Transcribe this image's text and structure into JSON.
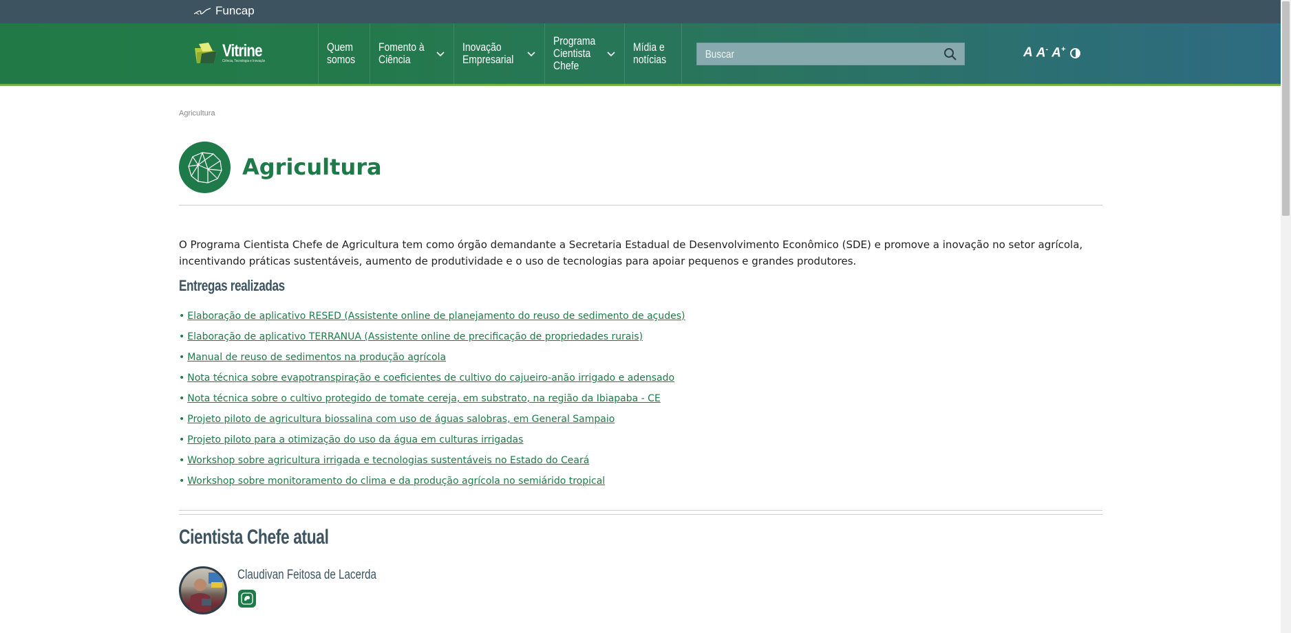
{
  "topbar": {
    "brand": "Funcap"
  },
  "header": {
    "logo_title": "Vitrine",
    "logo_tagline": "Ciência, Tecnologia e Inovação",
    "nav": [
      {
        "label": "Quem\nsomos",
        "has_dropdown": false
      },
      {
        "label": "Fomento à\nCiência",
        "has_dropdown": true
      },
      {
        "label": "Inovação\nEmpresarial",
        "has_dropdown": true
      },
      {
        "label": "Programa\nCientista\nChefe",
        "has_dropdown": true
      },
      {
        "label": "Mídia e\nnotícias",
        "has_dropdown": false
      }
    ],
    "search_placeholder": "Buscar",
    "a11y": {
      "font_normal": "A",
      "font_smaller": "A",
      "font_larger": "A"
    }
  },
  "breadcrumb": "Agricultura",
  "page_title": "Agricultura",
  "intro": "O Programa Cientista Chefe de Agricultura tem como órgão demandante a Secretaria Estadual de Desenvolvimento Econômico (SDE) e promove a inovação no setor agrícola, incentivando práticas sustentáveis, aumento de produtividade e o uso de tecnologias para apoiar pequenos e grandes produtores.",
  "deliveries_title": "Entregas realizadas",
  "deliveries": [
    "Elaboração de aplicativo RESED (Assistente online de planejamento do reuso de sedimento de açudes)",
    "Elaboração de aplicativo TERRANUA (Assistente online de precificação de propriedades rurais)",
    "Manual de reuso de sedimentos na produção agrícola",
    "Nota técnica sobre evapotranspiração e coeficientes de cultivo do cajueiro-anão irrigado e adensado",
    "Nota técnica sobre o cultivo protegido de tomate cereja, em substrato, na região da Ibiapaba - CE",
    "Projeto piloto de agricultura biossalina com uso de águas salobras, em General Sampaio",
    "Projeto piloto para a otimização do uso da água em culturas irrigadas",
    "Workshop sobre agricultura irrigada e tecnologias sustentáveis no Estado do Ceará",
    "Workshop sobre monitoramento do clima e da produção agrícola no semiárido tropical"
  ],
  "current_scientist_title": "Cientista Chefe atual",
  "scientist_name": "Claudivan Feitosa de Lacerda",
  "colors": {
    "primary_green": "#1e7a48",
    "top_strip": "#3d5360",
    "accent_line": "#6db33f"
  }
}
